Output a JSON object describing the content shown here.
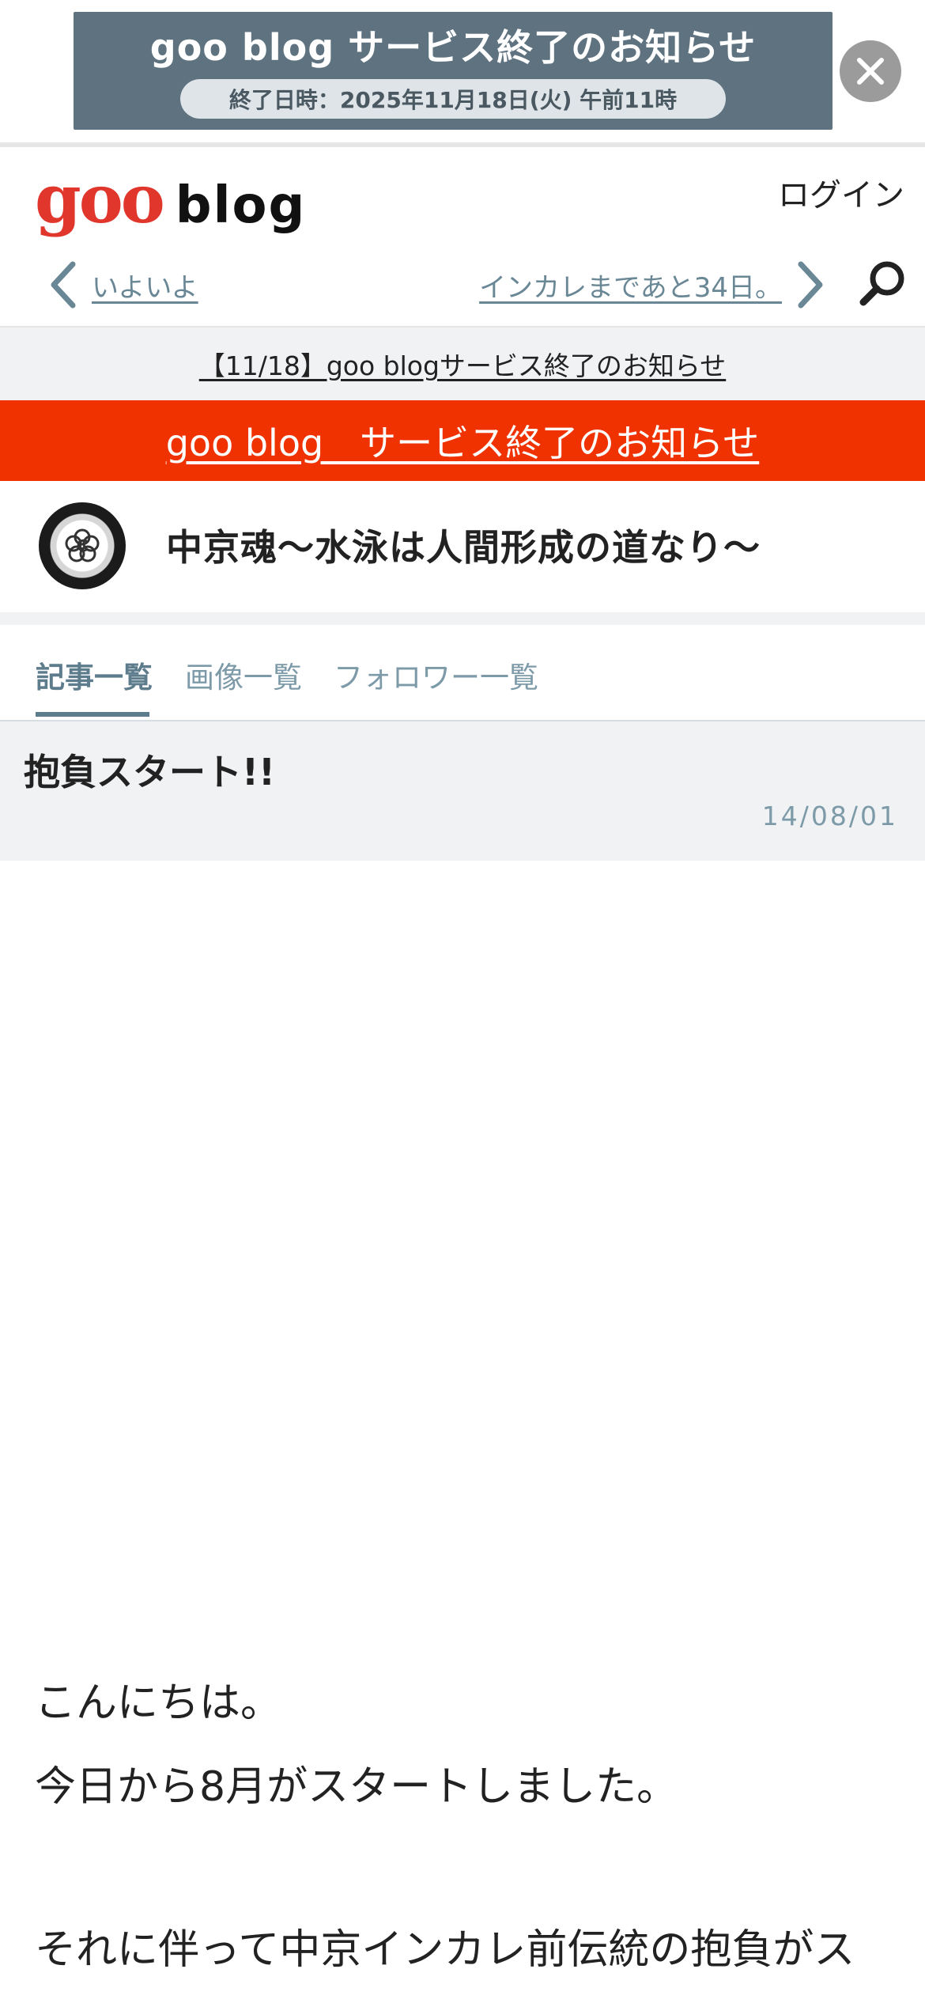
{
  "banner": {
    "title": "goo blog サービス終了のお知らせ",
    "date": "終了日時：2025年11月18日(火) 午前11時",
    "close_icon": "close-icon",
    "background": "#5e7280"
  },
  "header": {
    "logo_goo": "goo",
    "logo_blog": "blog",
    "login": "ログイン",
    "logo_color": "#e0362c"
  },
  "nav": {
    "prev_label": "いよいよ",
    "next_label": "インカレまであと34日。",
    "prev_icon": "chevron-left-icon",
    "next_icon": "chevron-right-icon",
    "search_icon": "search-icon"
  },
  "notice": {
    "text": "【11/18】goo blogサービス終了のお知らせ"
  },
  "red_bar": {
    "text": "goo blog　サービス終了のお知らせ",
    "color": "#ef3200"
  },
  "blog": {
    "title": "中京魂～水泳は人間形成の道なり～"
  },
  "tabs": [
    {
      "label": "記事一覧",
      "active": true
    },
    {
      "label": "画像一覧",
      "active": false
    },
    {
      "label": "フォロワー一覧",
      "active": false
    }
  ],
  "entry": {
    "title": "抱負スタート!!",
    "date": "14/08/01",
    "paragraphs": [
      "こんにちは。",
      "今日から8月がスタートしました。",
      "それに伴って中京インカレ前伝統の抱負がス"
    ]
  }
}
